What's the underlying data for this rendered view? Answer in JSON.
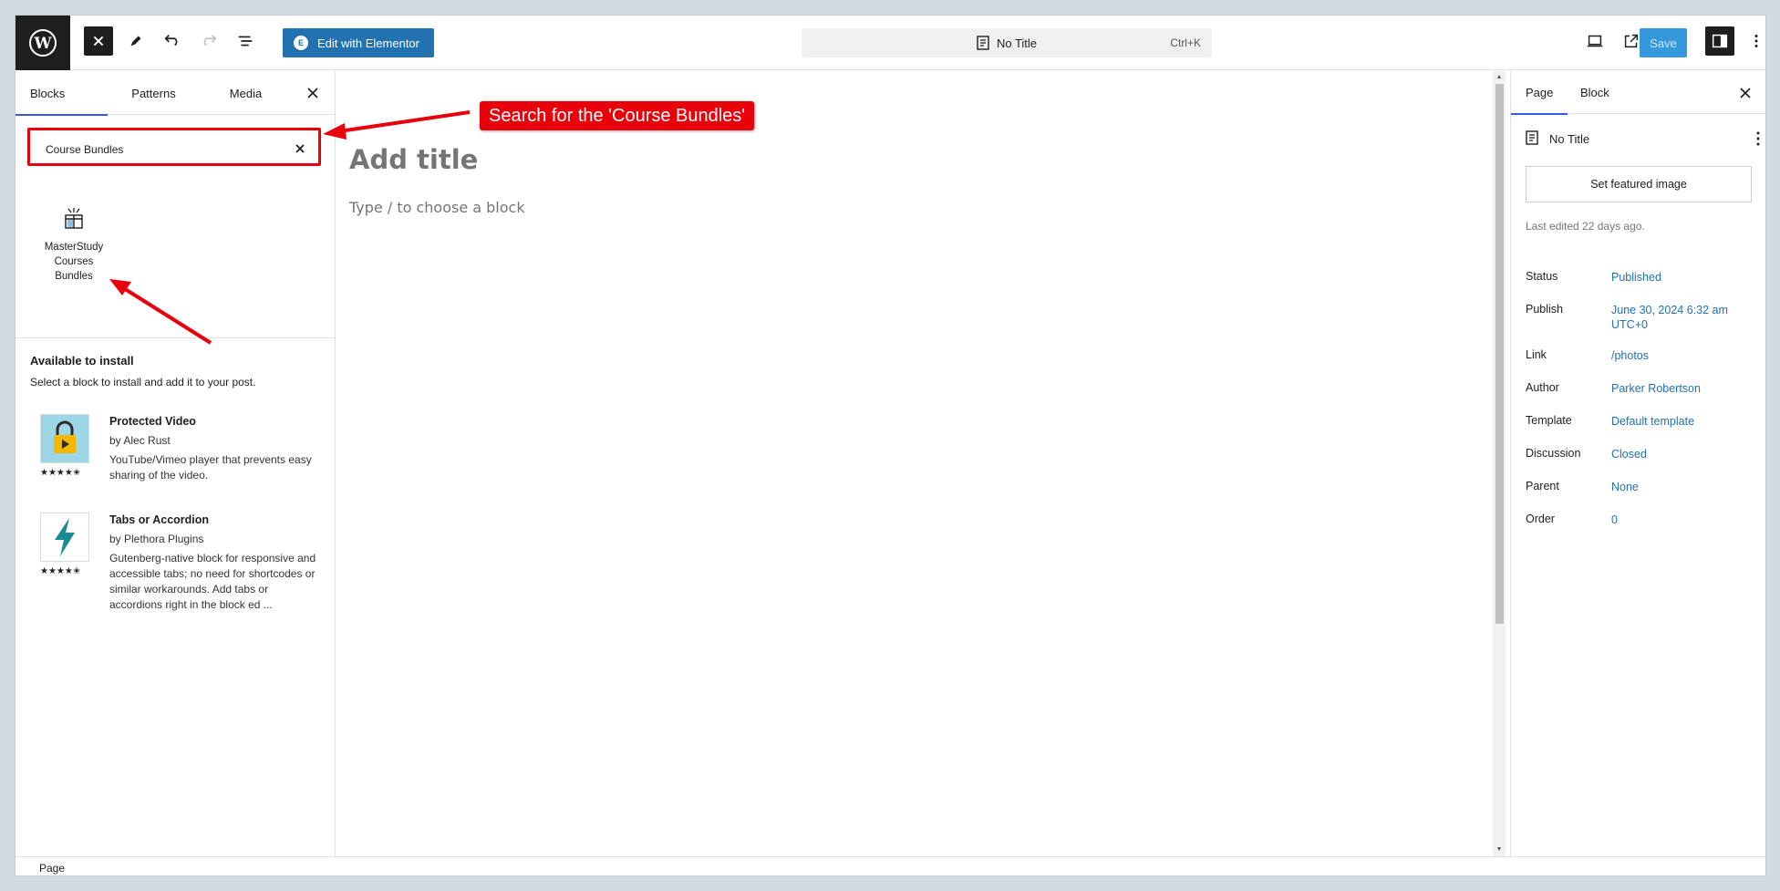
{
  "toolbar": {
    "elementor_label": "Edit with Elementor",
    "command_title": "No Title",
    "command_shortcut": "Ctrl+K",
    "save_label": "Save"
  },
  "inserter": {
    "tabs": [
      "Blocks",
      "Patterns",
      "Media"
    ],
    "search_value": "Course Bundles",
    "result_block": "MasterStudy Courses Bundles",
    "available_title": "Available to install",
    "available_desc": "Select a block to install and add it to your post.",
    "plugins": [
      {
        "name": "Protected Video",
        "author": "by Alec Rust",
        "desc": "YouTube/Vimeo player that prevents easy sharing of the video.",
        "stars": "★★★★✬"
      },
      {
        "name": "Tabs or Accordion",
        "author": "by Plethora Plugins",
        "desc": "Gutenberg-native block for responsive and accessible tabs; no need for shortcodes or similar workarounds. Add tabs or accordions right in the block ed ...",
        "stars": "★★★★✬"
      }
    ]
  },
  "editor": {
    "title_placeholder": "Add title",
    "block_hint": "Type / to choose a block"
  },
  "annotation": {
    "callout": "Search for the 'Course Bundles'"
  },
  "sidebar": {
    "tabs": [
      "Page",
      "Block"
    ],
    "doc_title": "No Title",
    "featured_label": "Set featured image",
    "last_edited": "Last edited 22 days ago.",
    "meta": [
      {
        "key": "Status",
        "value": "Published"
      },
      {
        "key": "Publish",
        "value": "June 30, 2024 6:32 am UTC+0"
      },
      {
        "key": "Link",
        "value": "/photos"
      },
      {
        "key": "Author",
        "value": "Parker Robertson"
      },
      {
        "key": "Template",
        "value": "Default template"
      },
      {
        "key": "Discussion",
        "value": "Closed"
      },
      {
        "key": "Parent",
        "value": "None"
      },
      {
        "key": "Order",
        "value": "0"
      }
    ]
  },
  "footer": {
    "breadcrumb": "Page"
  },
  "colors": {
    "accent": "#2271b1",
    "annotation": "#e8000b",
    "tab_indicator": "#3858e9"
  }
}
